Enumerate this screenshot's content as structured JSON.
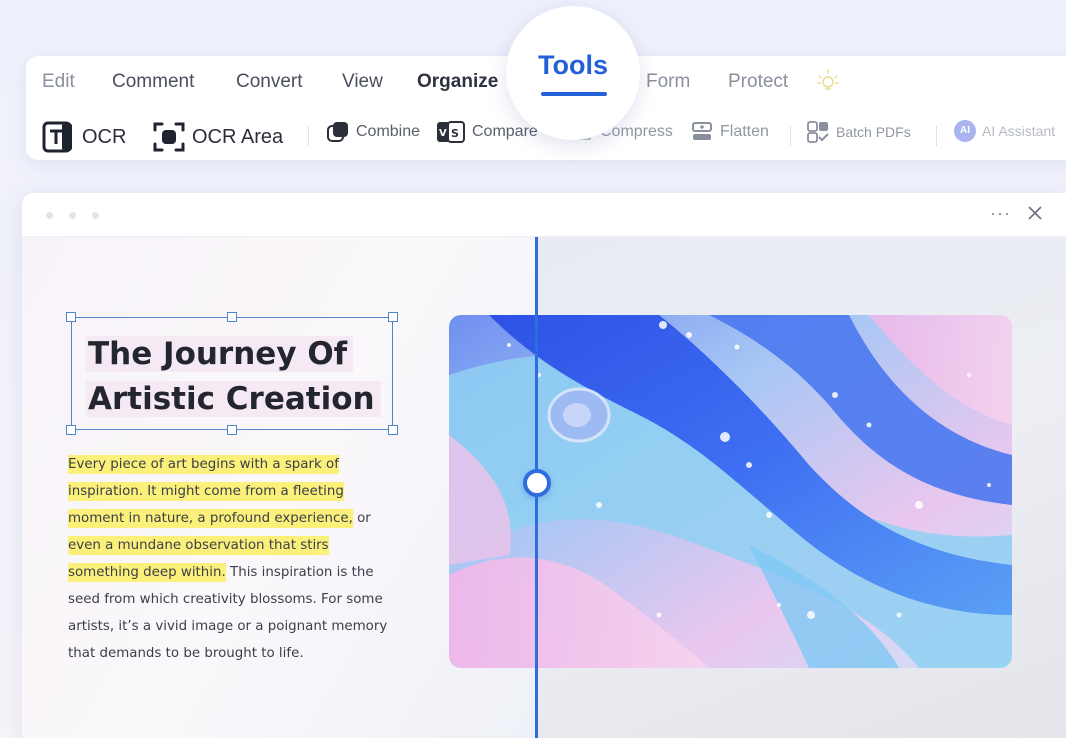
{
  "menu": {
    "edit": "Edit",
    "comment": "Comment",
    "convert": "Convert",
    "view": "View",
    "organize": "Organize",
    "tools": "Tools",
    "form": "Form",
    "protect": "Protect"
  },
  "tools": {
    "ocr": "OCR",
    "ocr_area": "OCR Area",
    "combine": "Combine",
    "compare": "Compare",
    "compress": "Compress",
    "flatten": "Flatten",
    "batch_pdfs": "Batch PDFs",
    "ai_assistant": "AI Assistant",
    "ai_badge": "AI"
  },
  "window": {
    "more": "···"
  },
  "document": {
    "title_line1": "The Journey Of",
    "title_line2": "Artistic Creation",
    "highlighted": [
      "Every piece of art begins with a spark of",
      "inspiration. It might come from a fleeting",
      "moment in nature, a profound experience,",
      "even a mundane observation that stirs",
      "something deep within."
    ],
    "after_highlight_3": " or",
    "after_highlight_5": " This inspiration is the",
    "plain_lines": [
      "seed from which creativity blossoms. For some",
      "artists, it’s a vivid image or a poignant memory",
      "that demands to be brought to life."
    ]
  },
  "colors": {
    "accent": "#2461d8",
    "highlight": "#fbf07a",
    "selection": "#4f86c9"
  },
  "icons": {
    "ocr": "ocr-icon",
    "ocr_area": "ocr-area-icon",
    "combine": "combine-icon",
    "compare": "compare-icon",
    "compress": "compress-icon",
    "flatten": "flatten-icon",
    "batch": "batch-pdfs-icon",
    "ai": "ai-assistant-icon",
    "bulb": "lightbulb-icon",
    "close": "close-icon"
  }
}
